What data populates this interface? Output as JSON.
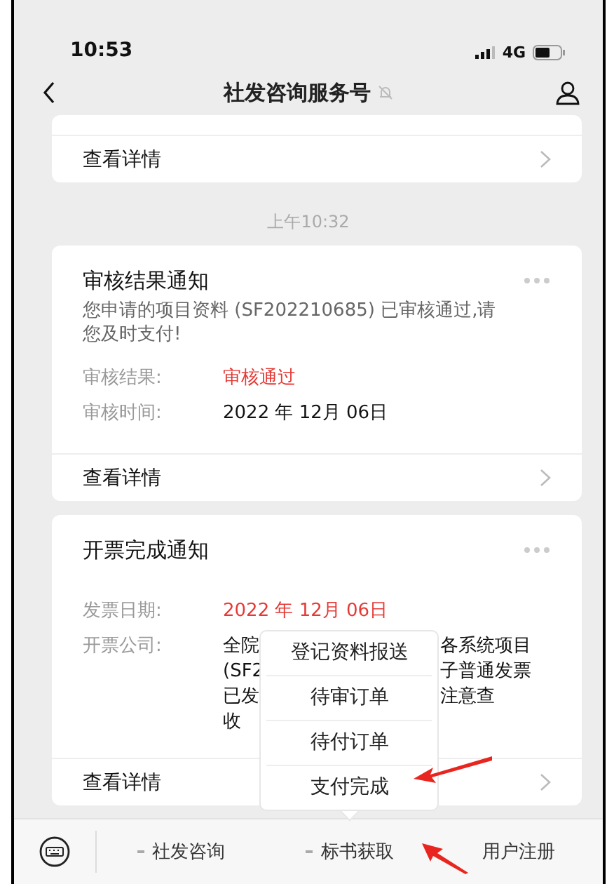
{
  "status_bar": {
    "time": "10:53",
    "network": "4G"
  },
  "nav": {
    "title": "社发咨询服务号",
    "muted": true
  },
  "messages": [
    {
      "kind": "partial",
      "link": "查看详情"
    },
    {
      "kind": "time",
      "text": "上午10:32"
    },
    {
      "kind": "notice",
      "title": "审核结果通知",
      "body": "您申请的项目资料 (SF202210685) 已审核通过,请您及时支付!",
      "fields": [
        {
          "label": "审核结果:",
          "value": "审核通过",
          "highlight": true
        },
        {
          "label": "审核时间:",
          "value": "2022 年 12月 06日",
          "highlight": false
        }
      ],
      "link": "查看详情"
    },
    {
      "kind": "notice",
      "title": "开票完成通知",
      "fields": [
        {
          "label": "发票日期:",
          "value": "2022 年 12月 06日",
          "highlight": true
        },
        {
          "label": "开票公司:",
          "covered": {
            "left": [
              "全院",
              "(SF2",
              "已发",
              "收"
            ],
            "right": [
              "各系统项目",
              "子普通发票",
              "注意查"
            ]
          }
        }
      ],
      "link": "查看详情"
    }
  ],
  "menu_bar": {
    "items": [
      {
        "label": "社发咨询",
        "has_submenu": true,
        "expanded": false
      },
      {
        "label": "标书获取",
        "has_submenu": true,
        "expanded": true
      },
      {
        "label": "用户注册",
        "has_submenu": false
      }
    ]
  },
  "popup": {
    "items": [
      "登记资料报送",
      "待审订单",
      "待付订单",
      "支付完成"
    ]
  }
}
